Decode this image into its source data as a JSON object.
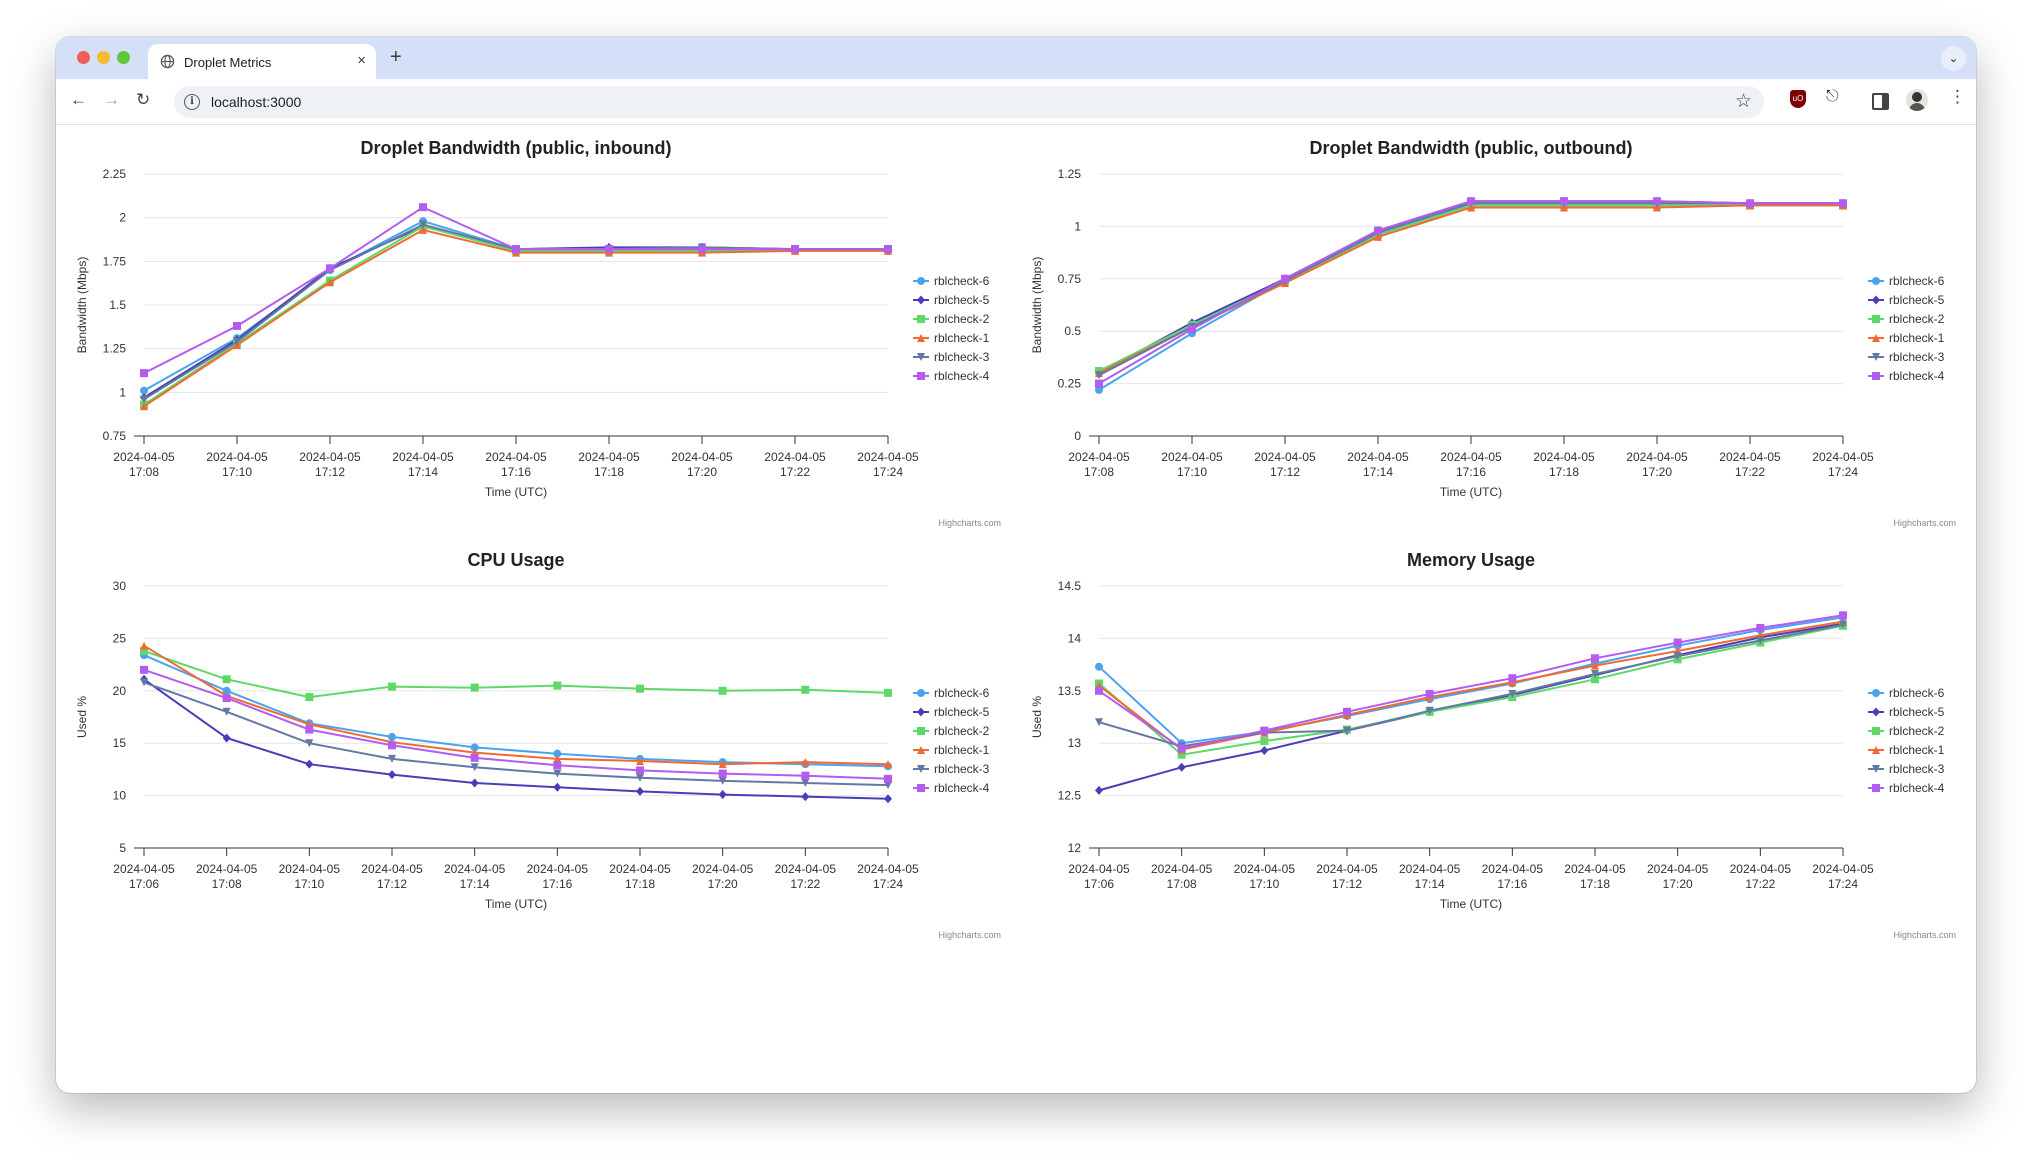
{
  "browser": {
    "tab_title": "Droplet Metrics",
    "tab_close": "×",
    "new_tab": "+",
    "url": "localhost:3000",
    "icons": [
      "globe-icon",
      "back-arrow-icon",
      "forward-arrow-icon",
      "reload-icon",
      "info-icon",
      "star-icon",
      "ublock-icon",
      "puzzle-icon",
      "side-panel-icon",
      "avatar",
      "more-vert-icon",
      "tab-search-icon"
    ]
  },
  "colors": {
    "rblcheck-6": "#4aa3ef",
    "rblcheck-5": "#4a3db8",
    "rblcheck-2": "#5fd86a",
    "rblcheck-1": "#f06a32",
    "rblcheck-3": "#6478a6",
    "rblcheck-4": "#b25cf0"
  },
  "chart_data": [
    {
      "type": "line",
      "title": "Droplet Bandwidth (public, inbound)",
      "xlabel": "Time (UTC)",
      "ylabel": "Bandwidth (Mbps)",
      "credits": "Highcharts.com",
      "ylim": [
        0.75,
        2.25
      ],
      "yticks": [
        "0.75",
        "1",
        "1.25",
        "1.5",
        "1.75",
        "2",
        "2.25"
      ],
      "categories": [
        "2024-04-05 17:08",
        "2024-04-05 17:10",
        "2024-04-05 17:12",
        "2024-04-05 17:14",
        "2024-04-05 17:16",
        "2024-04-05 17:18",
        "2024-04-05 17:20",
        "2024-04-05 17:22",
        "2024-04-05 17:24"
      ],
      "legend": "right",
      "series": [
        {
          "name": "rblcheck-6",
          "values": [
            1.01,
            1.31,
            1.7,
            1.98,
            1.82,
            1.82,
            1.82,
            1.82,
            1.82
          ]
        },
        {
          "name": "rblcheck-5",
          "values": [
            0.97,
            1.3,
            1.71,
            1.95,
            1.82,
            1.83,
            1.83,
            1.82,
            1.82
          ]
        },
        {
          "name": "rblcheck-2",
          "values": [
            0.93,
            1.28,
            1.64,
            1.95,
            1.81,
            1.81,
            1.81,
            1.82,
            1.82
          ]
        },
        {
          "name": "rblcheck-1",
          "values": [
            0.92,
            1.27,
            1.63,
            1.93,
            1.8,
            1.8,
            1.8,
            1.81,
            1.81
          ]
        },
        {
          "name": "rblcheck-3",
          "values": [
            0.96,
            1.29,
            1.7,
            1.96,
            1.82,
            1.82,
            1.83,
            1.82,
            1.82
          ]
        },
        {
          "name": "rblcheck-4",
          "values": [
            1.11,
            1.38,
            1.71,
            2.06,
            1.82,
            1.82,
            1.82,
            1.82,
            1.82
          ]
        }
      ]
    },
    {
      "type": "line",
      "title": "Droplet Bandwidth (public, outbound)",
      "xlabel": "Time (UTC)",
      "ylabel": "Bandwidth (Mbps)",
      "credits": "Highcharts.com",
      "ylim": [
        0,
        1.25
      ],
      "yticks": [
        "0",
        "0.25",
        "0.5",
        "0.75",
        "1",
        "1.25"
      ],
      "categories": [
        "2024-04-05 17:08",
        "2024-04-05 17:10",
        "2024-04-05 17:12",
        "2024-04-05 17:14",
        "2024-04-05 17:16",
        "2024-04-05 17:18",
        "2024-04-05 17:20",
        "2024-04-05 17:22",
        "2024-04-05 17:24"
      ],
      "legend": "right",
      "series": [
        {
          "name": "rblcheck-6",
          "values": [
            0.22,
            0.49,
            0.74,
            0.97,
            1.11,
            1.11,
            1.11,
            1.11,
            1.11
          ]
        },
        {
          "name": "rblcheck-5",
          "values": [
            0.3,
            0.54,
            0.75,
            0.98,
            1.12,
            1.12,
            1.12,
            1.11,
            1.11
          ]
        },
        {
          "name": "rblcheck-2",
          "values": [
            0.31,
            0.53,
            0.74,
            0.96,
            1.1,
            1.1,
            1.1,
            1.1,
            1.1
          ]
        },
        {
          "name": "rblcheck-1",
          "values": [
            0.3,
            0.52,
            0.73,
            0.95,
            1.09,
            1.09,
            1.09,
            1.1,
            1.1
          ]
        },
        {
          "name": "rblcheck-3",
          "values": [
            0.29,
            0.52,
            0.74,
            0.97,
            1.11,
            1.11,
            1.11,
            1.11,
            1.11
          ]
        },
        {
          "name": "rblcheck-4",
          "values": [
            0.25,
            0.51,
            0.75,
            0.98,
            1.12,
            1.12,
            1.12,
            1.11,
            1.11
          ]
        }
      ]
    },
    {
      "type": "line",
      "title": "CPU Usage",
      "xlabel": "Time (UTC)",
      "ylabel": "Used %",
      "credits": "Highcharts.com",
      "ylim": [
        5,
        30
      ],
      "yticks": [
        "5",
        "10",
        "15",
        "20",
        "25",
        "30"
      ],
      "categories": [
        "2024-04-05 17:06",
        "2024-04-05 17:08",
        "2024-04-05 17:10",
        "2024-04-05 17:12",
        "2024-04-05 17:14",
        "2024-04-05 17:16",
        "2024-04-05 17:18",
        "2024-04-05 17:20",
        "2024-04-05 17:22",
        "2024-04-05 17:24"
      ],
      "legend": "right",
      "series": [
        {
          "name": "rblcheck-6",
          "values": [
            23.4,
            20.0,
            16.9,
            15.6,
            14.6,
            14.0,
            13.5,
            13.2,
            13.0,
            12.8
          ]
        },
        {
          "name": "rblcheck-5",
          "values": [
            21.1,
            15.5,
            13.0,
            12.0,
            11.2,
            10.8,
            10.4,
            10.1,
            9.9,
            9.7
          ]
        },
        {
          "name": "rblcheck-2",
          "values": [
            23.8,
            21.1,
            19.4,
            20.4,
            20.3,
            20.5,
            20.2,
            20.0,
            20.1,
            19.8
          ]
        },
        {
          "name": "rblcheck-1",
          "values": [
            24.3,
            19.5,
            16.8,
            15.1,
            14.1,
            13.5,
            13.3,
            13.0,
            13.2,
            13.0
          ]
        },
        {
          "name": "rblcheck-3",
          "values": [
            20.8,
            18.0,
            15.0,
            13.5,
            12.7,
            12.1,
            11.7,
            11.4,
            11.2,
            11.0
          ]
        },
        {
          "name": "rblcheck-4",
          "values": [
            22.0,
            19.3,
            16.3,
            14.8,
            13.6,
            12.9,
            12.4,
            12.1,
            11.9,
            11.6
          ]
        }
      ]
    },
    {
      "type": "line",
      "title": "Memory Usage",
      "xlabel": "Time (UTC)",
      "ylabel": "Used %",
      "credits": "Highcharts.com",
      "ylim": [
        12,
        14.5
      ],
      "yticks": [
        "12",
        "12.5",
        "13",
        "13.5",
        "14",
        "14.5"
      ],
      "categories": [
        "2024-04-05 17:06",
        "2024-04-05 17:08",
        "2024-04-05 17:10",
        "2024-04-05 17:12",
        "2024-04-05 17:14",
        "2024-04-05 17:16",
        "2024-04-05 17:18",
        "2024-04-05 17:20",
        "2024-04-05 17:22",
        "2024-04-05 17:24"
      ],
      "legend": "right",
      "series": [
        {
          "name": "rblcheck-6",
          "values": [
            13.73,
            13.0,
            13.11,
            13.26,
            13.42,
            13.57,
            13.76,
            13.93,
            14.08,
            14.2
          ]
        },
        {
          "name": "rblcheck-5",
          "values": [
            12.55,
            12.77,
            12.93,
            13.12,
            13.3,
            13.46,
            13.65,
            13.84,
            14.01,
            14.14
          ]
        },
        {
          "name": "rblcheck-2",
          "values": [
            13.57,
            12.89,
            13.02,
            13.13,
            13.3,
            13.44,
            13.61,
            13.8,
            13.96,
            14.12
          ]
        },
        {
          "name": "rblcheck-1",
          "values": [
            13.55,
            12.94,
            13.1,
            13.27,
            13.44,
            13.58,
            13.74,
            13.88,
            14.03,
            14.16
          ]
        },
        {
          "name": "rblcheck-3",
          "values": [
            13.2,
            12.97,
            13.1,
            13.12,
            13.31,
            13.47,
            13.66,
            13.83,
            13.98,
            14.13
          ]
        },
        {
          "name": "rblcheck-4",
          "values": [
            13.5,
            12.95,
            13.12,
            13.3,
            13.47,
            13.62,
            13.81,
            13.96,
            14.1,
            14.22
          ]
        }
      ]
    }
  ]
}
